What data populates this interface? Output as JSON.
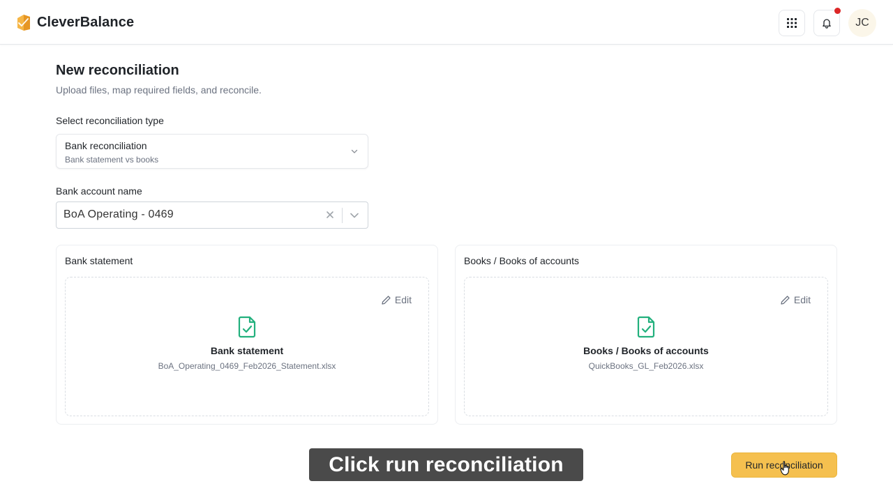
{
  "app": {
    "name": "CleverBalance",
    "brand_color": "#f0a830",
    "user_initials": "JC"
  },
  "header": {
    "icons": [
      "apps-grid-icon",
      "bell-icon"
    ],
    "notification_dot_color": "#dc2626"
  },
  "page": {
    "title": "New reconciliation",
    "subtitle": "Upload files, map required fields, and reconcile."
  },
  "reconciliation_type": {
    "label": "Select reconciliation type",
    "selected": "Bank reconciliation",
    "description": "Bank statement vs books"
  },
  "bank_account": {
    "label": "Bank account name",
    "value": "BoA Operating - 0469"
  },
  "uploads": {
    "bank": {
      "panel_title": "Bank statement",
      "edit_label": "Edit",
      "file_title": "Bank statement",
      "file_name": "BoA_Operating_0469_Feb2026_Statement.xlsx"
    },
    "books": {
      "panel_title": "Books / Books of accounts",
      "edit_label": "Edit",
      "file_title": "Books / Books of accounts",
      "file_name": "QuickBooks_GL_Feb2026.xlsx"
    }
  },
  "actions": {
    "run_label": "Run reconciliation",
    "run_color": "#f5c04f"
  },
  "caption": {
    "text": "Click run reconciliation"
  },
  "colors": {
    "file_icon": "#22b07d"
  }
}
